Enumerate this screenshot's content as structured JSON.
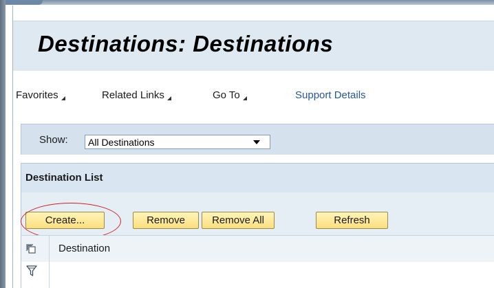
{
  "header": {
    "title": "Destinations: Destinations"
  },
  "toolbar": {
    "menus": [
      {
        "label": "Favorites"
      },
      {
        "label": "Related Links"
      },
      {
        "label": "Go To"
      }
    ],
    "support_link": "Support Details"
  },
  "show": {
    "label": "Show:",
    "selected": "All Destinations"
  },
  "destination_list": {
    "title": "Destination List",
    "buttons": {
      "create": "Create...",
      "remove": "Remove",
      "remove_all": "Remove All",
      "refresh": "Refresh"
    },
    "columns": [
      {
        "label": "Destination"
      }
    ]
  },
  "annotation": {
    "highlight_color": "#d32121"
  },
  "colors": {
    "title_band": "#dfe9f2",
    "panel": "#d5e2ee",
    "button": "#fbdf7e",
    "link": "#24579a"
  }
}
